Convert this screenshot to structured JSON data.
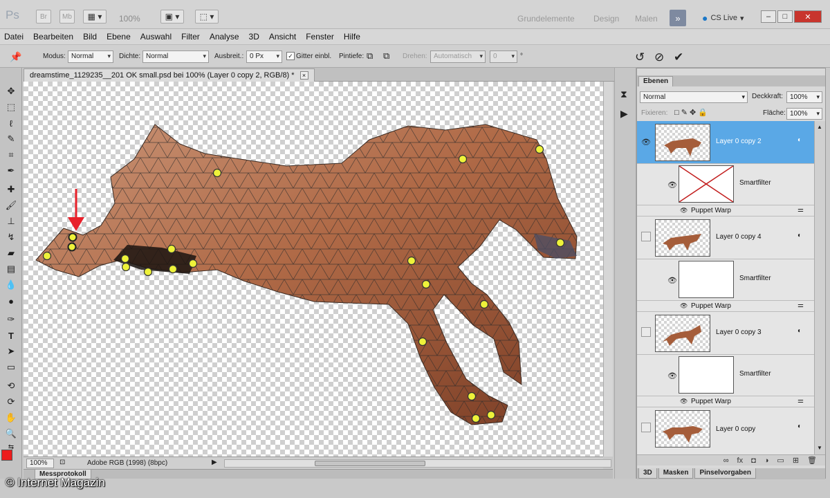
{
  "app": {
    "logo": "Ps",
    "bridge_btn": "Br",
    "minibridge_btn": "Mb",
    "zoom": "100%",
    "workspaces": [
      "Grundelemente",
      "Design",
      "Malen"
    ],
    "workspace_more": "»",
    "cslive": "CS Live",
    "window_controls": [
      "–",
      "□",
      "✕"
    ]
  },
  "menu": [
    "Datei",
    "Bearbeiten",
    "Bild",
    "Ebene",
    "Auswahl",
    "Filter",
    "Analyse",
    "3D",
    "Ansicht",
    "Fenster",
    "Hilfe"
  ],
  "options": {
    "modus_label": "Modus:",
    "modus_value": "Normal",
    "dichte_label": "Dichte:",
    "dichte_value": "Normal",
    "ausbreit_label": "Ausbreit.:",
    "ausbreit_value": "0 Px",
    "gitter_label": "Gitter einbl.",
    "gitter_checked": "✓",
    "pintiefe_label": "Pintiefe:",
    "drehen_label": "Drehen:",
    "drehen_value": "Automatisch",
    "drehen_angle": "0",
    "degree": "°"
  },
  "document": {
    "tab_title": "dreamstime_1129235__201 OK small.psd bei 100% (Layer 0 copy 2, RGB/8) *",
    "close": "×",
    "status_zoom": "100%",
    "status_info": "Adobe RGB (1998) (8bpc)"
  },
  "bottom_panel": {
    "tab": "Messprotokoll"
  },
  "layers_panel": {
    "tab": "Ebenen",
    "blend_mode": "Normal",
    "opacity_label": "Deckkraft:",
    "opacity_value": "100%",
    "lock_label": "Fixieren:",
    "fill_label": "Fläche:",
    "fill_value": "100%",
    "layers": [
      {
        "name": "Layer 0 copy 2",
        "selected": true,
        "filter_label": "Smartfilter",
        "filter_name": "Puppet Warp"
      },
      {
        "name": "Layer 0 copy 4",
        "selected": false,
        "filter_label": "Smartfilter",
        "filter_name": "Puppet Warp"
      },
      {
        "name": "Layer 0 copy 3",
        "selected": false,
        "filter_label": "Smartfilter",
        "filter_name": "Puppet Warp"
      },
      {
        "name": "Layer 0 copy",
        "selected": false
      }
    ],
    "bottom_tabs": [
      "3D",
      "Masken",
      "Pinselvorgaben"
    ]
  },
  "watermark": "© Internet Magazin",
  "colors": {
    "selected_layer": "#5aa8e6",
    "foreground": "#ec1c1c",
    "pin": "#eef23a",
    "arrow": "#e8202a"
  }
}
